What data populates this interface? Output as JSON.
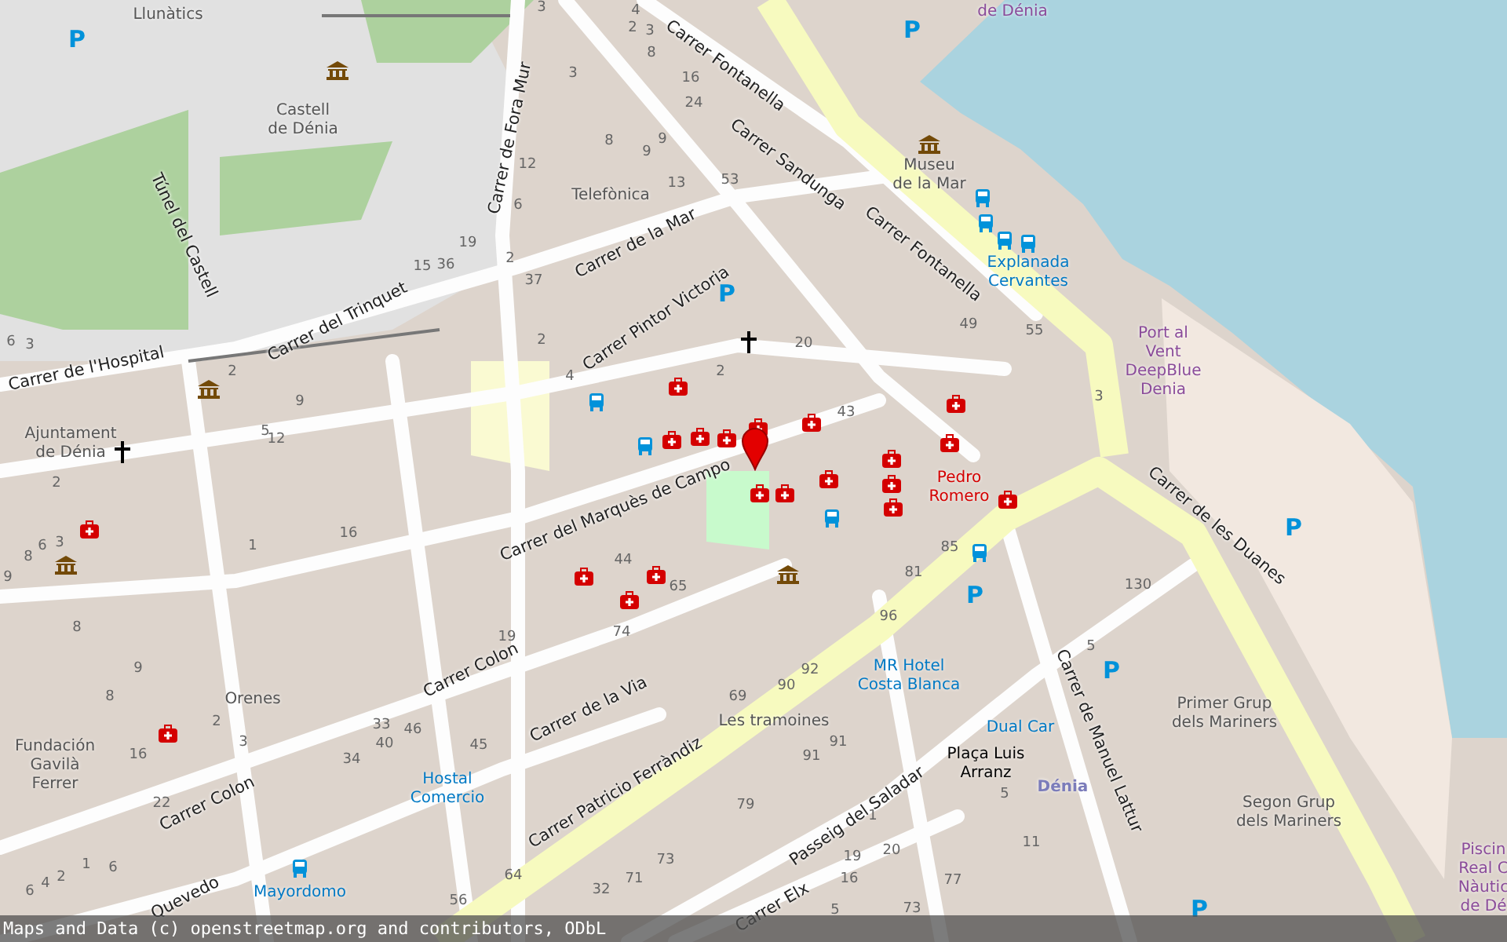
{
  "streets": [
    {
      "name": "Carrer de l'Hospital"
    },
    {
      "name": "Carrer del Trinquet"
    },
    {
      "name": "Túnel del Castell"
    },
    {
      "name": "Carrer de Fora Mur"
    },
    {
      "name": "Carrer de la Mar"
    },
    {
      "name": "Carrer Pintor Victoria"
    },
    {
      "name": "Carrer Fontanella"
    },
    {
      "name": "Carrer Sandunga"
    },
    {
      "name": "Carrer Fontanella"
    },
    {
      "name": "Carrer del Marquès de Campo"
    },
    {
      "name": "Carrer Colon"
    },
    {
      "name": "Carrer de la Via"
    },
    {
      "name": "Carrer Colon"
    },
    {
      "name": "Quevedo"
    },
    {
      "name": "Carrer Patricio Ferràndiz"
    },
    {
      "name": "Passeig del Saladar"
    },
    {
      "name": "Carrer Elx"
    },
    {
      "name": "Carrer de Manuel Lattur"
    },
    {
      "name": "Carrer de les Duanes"
    }
  ],
  "places": [
    {
      "name": "Llunàtics",
      "kind": "place"
    },
    {
      "name": "Castell\nde Dénia",
      "kind": "place"
    },
    {
      "name": "Telefònica",
      "kind": "place"
    },
    {
      "name": "Museu\nde la Mar",
      "kind": "place"
    },
    {
      "name": "Explanada\nCervantes",
      "kind": "transit"
    },
    {
      "name": "Port al\nVent\nDeepBlue\nDenia",
      "kind": "leisure"
    },
    {
      "name": "Ajuntament\nde Dénia",
      "kind": "place"
    },
    {
      "name": "Pedro\nRomero",
      "kind": "health"
    },
    {
      "name": "Orenes",
      "kind": "place"
    },
    {
      "name": "Fundación\nGavilà\nFerrer",
      "kind": "place"
    },
    {
      "name": "Hostal\nComercio",
      "kind": "transit"
    },
    {
      "name": "Mayordomo",
      "kind": "transit"
    },
    {
      "name": "Les tramoines",
      "kind": "place"
    },
    {
      "name": "MR Hotel\nCosta Blanca",
      "kind": "transit"
    },
    {
      "name": "Dual Car",
      "kind": "transit"
    },
    {
      "name": "Plaça Luis\nArranz",
      "kind": "square"
    },
    {
      "name": "Dénia",
      "kind": "station"
    },
    {
      "name": "Primer Grup\ndels Mariners",
      "kind": "place"
    },
    {
      "name": "Segon Grup\ndels Mariners",
      "kind": "place"
    },
    {
      "name": "de Dénia",
      "kind": "leisure"
    },
    {
      "name": "Piscin\nReal C\nNàutic\nde Dé",
      "kind": "leisure"
    }
  ],
  "house_numbers": [
    "3",
    "4",
    "2",
    "3",
    "8",
    "16",
    "24",
    "3",
    "8",
    "9",
    "9",
    "13",
    "53",
    "12",
    "6",
    "19",
    "15",
    "36",
    "2",
    "37",
    "2",
    "4",
    "2",
    "2",
    "9",
    "5",
    "12",
    "6",
    "3",
    "20",
    "49",
    "55",
    "43",
    "3",
    "2",
    "16",
    "1",
    "8",
    "6",
    "3",
    "9",
    "44",
    "65",
    "8",
    "19",
    "74",
    "9",
    "8",
    "2",
    "3",
    "16",
    "33",
    "46",
    "40",
    "34",
    "45",
    "22",
    "69",
    "79",
    "73",
    "64",
    "71",
    "32",
    "1",
    "6",
    "2",
    "4",
    "6",
    "56",
    "85",
    "81",
    "130",
    "96",
    "92",
    "90",
    "5",
    "91",
    "91",
    "5",
    "1",
    "11",
    "19",
    "20",
    "16",
    "77",
    "73",
    "5"
  ],
  "parking_signs": [
    "P",
    "P",
    "P",
    "P",
    "P",
    "P",
    "P"
  ],
  "attribution": "Maps and Data (c) openstreetmap.org and contributors, ODbL"
}
